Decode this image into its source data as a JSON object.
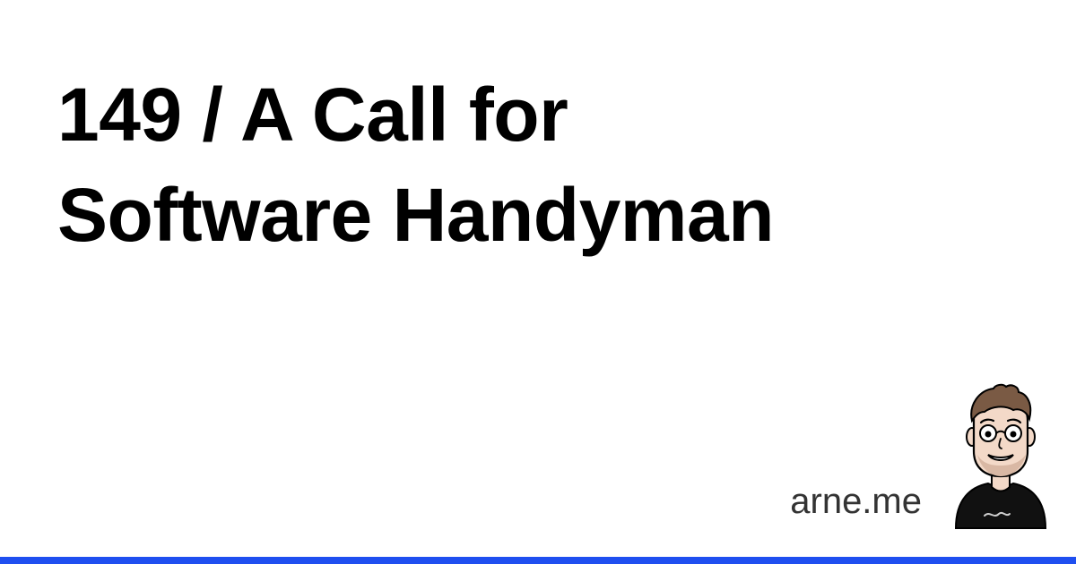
{
  "title": {
    "line1": "149 / A Call for",
    "line2": "Software Handyman"
  },
  "site": {
    "domain": "arne.me"
  },
  "avatar": {
    "icon": "cartoon-portrait-icon"
  },
  "colors": {
    "background": "#ffffff",
    "title": "#000000",
    "domain": "#333333",
    "accent_bar": "#1f4ff0"
  }
}
